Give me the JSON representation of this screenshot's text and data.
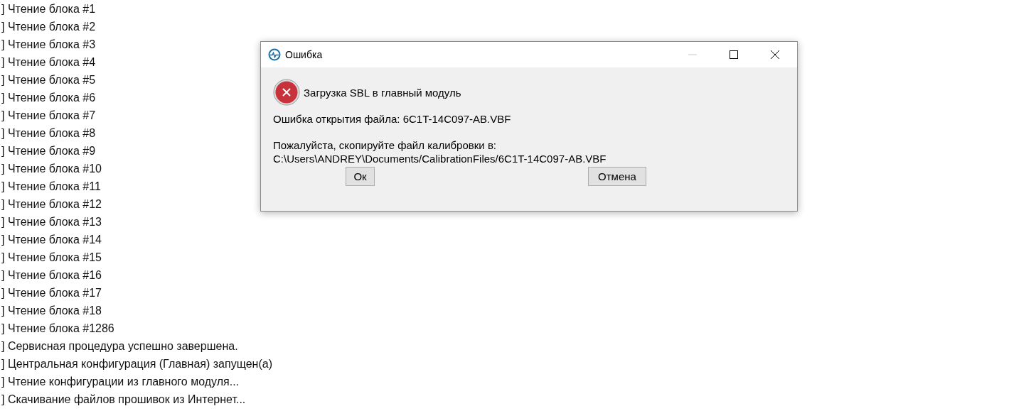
{
  "log_lines": [
    "] Чтение блока #1",
    "] Чтение блока #2",
    "] Чтение блока #3",
    "] Чтение блока #4",
    "] Чтение блока #5",
    "] Чтение блока #6",
    "] Чтение блока #7",
    "] Чтение блока #8",
    "] Чтение блока #9",
    "] Чтение блока #10",
    "] Чтение блока #11",
    "] Чтение блока #12",
    "] Чтение блока #13",
    "] Чтение блока #14",
    "] Чтение блока #15",
    "] Чтение блока #16",
    "] Чтение блока #17",
    "] Чтение блока #18",
    "] Чтение блока #1286",
    "] Сервисная процедура успешно завершена.",
    "] Центральная конфигурация (Главная) запущен(а)",
    "] Чтение конфигурации из главного модуля...",
    "] Скачивание файлов прошивок из Интернет..."
  ],
  "dialog": {
    "title": "Ошибка",
    "heading": "Загрузка SBL в главный модуль",
    "message": "Ошибка открытия файла: 6C1T-14C097-AB.VBF",
    "instruction": "Пожалуйста, скопируйте файл калибровки в:",
    "path": "C:\\Users\\ANDREY\\Documents/CalibrationFiles/6C1T-14C097-AB.VBF",
    "buttons": [
      "Ок",
      "Отмена"
    ]
  }
}
